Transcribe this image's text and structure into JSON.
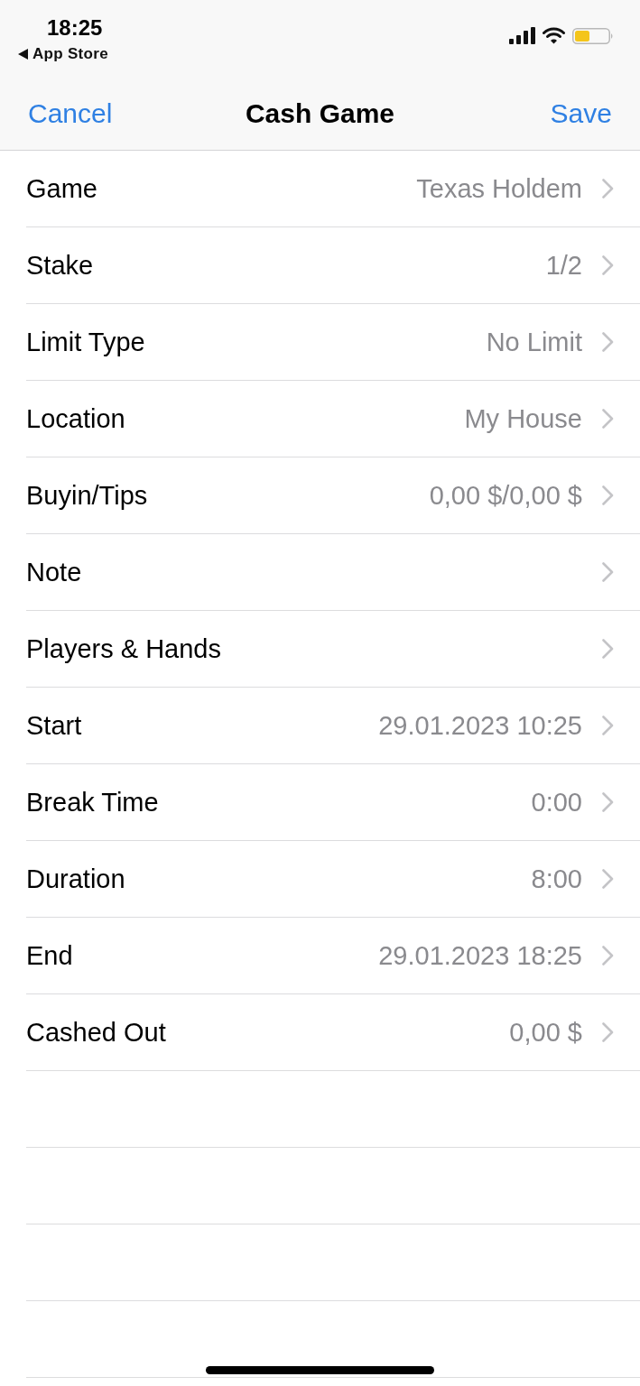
{
  "status_bar": {
    "time": "18:25",
    "back_label": "App Store"
  },
  "nav_bar": {
    "cancel": "Cancel",
    "title": "Cash Game",
    "save": "Save"
  },
  "rows": [
    {
      "label": "Game",
      "value": "Texas Holdem"
    },
    {
      "label": "Stake",
      "value": "1/2"
    },
    {
      "label": "Limit Type",
      "value": "No Limit"
    },
    {
      "label": "Location",
      "value": "My House"
    },
    {
      "label": "Buyin/Tips",
      "value": "0,00 $/0,00 $"
    },
    {
      "label": "Note"
    },
    {
      "label": "Players & Hands"
    },
    {
      "label": "Start",
      "value": "29.01.2023 10:25"
    },
    {
      "label": "Break Time",
      "value": "0:00"
    },
    {
      "label": "Duration",
      "value": "8:00"
    },
    {
      "label": "End",
      "value": "29.01.2023 18:25"
    },
    {
      "label": "Cashed Out",
      "value": "0,00 $"
    }
  ]
}
